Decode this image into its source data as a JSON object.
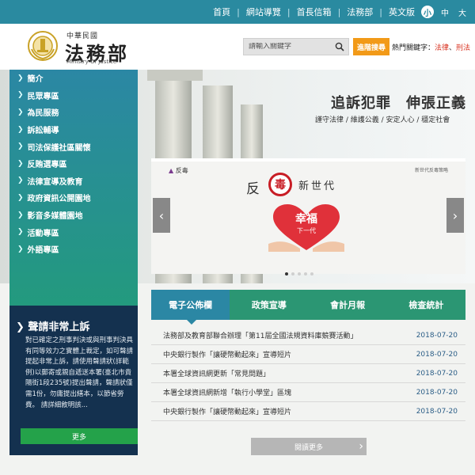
{
  "topnav": {
    "links": [
      "首頁",
      "網站導覽",
      "首長信箱",
      "法務部",
      "英文版"
    ],
    "font_sizes": [
      "小",
      "中",
      "大"
    ]
  },
  "header": {
    "logo_small": "中華民國",
    "logo_title": "法務部",
    "logo_en": "Ministry Of Justice",
    "search_placeholder": "請輸入關鍵字",
    "advanced_search": "進階搜尋",
    "hot_label": "熱門關鍵字：",
    "hot_keywords": [
      "法律",
      "刑法"
    ]
  },
  "hero": {
    "slogan": "追訴犯罪　伸張正義",
    "slogan_sub": "謹守法律 / 維護公義 / 安定人心 / 穩定社會"
  },
  "sidebar": {
    "items": [
      "簡介",
      "民眾專區",
      "為民服務",
      "訴訟輔導",
      "司法保護社區關懷",
      "反賄選專區",
      "法律宣導及教育",
      "政府資訊公開園地",
      "影音多媒體園地",
      "活動專區",
      "外語專區"
    ]
  },
  "notice": {
    "title": "聲請非常上訴",
    "body": "對已確定之刑事判決或與刑事判決具有同等效力之實體上裁定，如可聲請提起非常上訴，請使用聲請狀(詳範例)以郵寄或親自遞送本署(臺北市貴陽街1段235號)提出聲請，聲請狀僅需1份，勿庸提出繕本，以節省勞費。 請詳細敘明該...",
    "more": "更多"
  },
  "carousel": {
    "logo_text": "反毒",
    "corner_text": "新世代反毒策略",
    "title_left": "反",
    "stamp": "毒",
    "title_right": "新世代",
    "heart_text": "幸福",
    "heart_sub": "下一代",
    "prev_icon": "‹",
    "next_icon": "›",
    "dot_count": 5,
    "active_dot": 0
  },
  "tabs": {
    "items": [
      "電子公佈欄",
      "政策宣導",
      "會計月報",
      "檢查統計"
    ],
    "active": 0
  },
  "news": [
    {
      "title": "法務部及教育部聯合辦理「第11屆全國法規資料庫競賽活動」",
      "date": "2018-07-20"
    },
    {
      "title": "中央銀行製作「讓硬幣動起來」宣導短片",
      "date": "2018-07-20"
    },
    {
      "title": "本署全球資訊網更新「常見問題」",
      "date": "2018-07-20"
    },
    {
      "title": "本署全球資訊網新增「執行小學堂」區塊",
      "date": "2018-07-20"
    },
    {
      "title": "中央銀行製作「讓硬幣動起來」宣導短片",
      "date": "2018-07-20"
    }
  ],
  "read_more": "閱讀更多",
  "colors": {
    "topbar": "#2a8aa0",
    "accent_orange": "#f29a18",
    "sidebar_top": "#2b87a4",
    "sidebar_bottom": "#239a7e",
    "notice_bg": "#14314f",
    "green_button": "#24a24a",
    "keyword_red": "#d8301e"
  }
}
